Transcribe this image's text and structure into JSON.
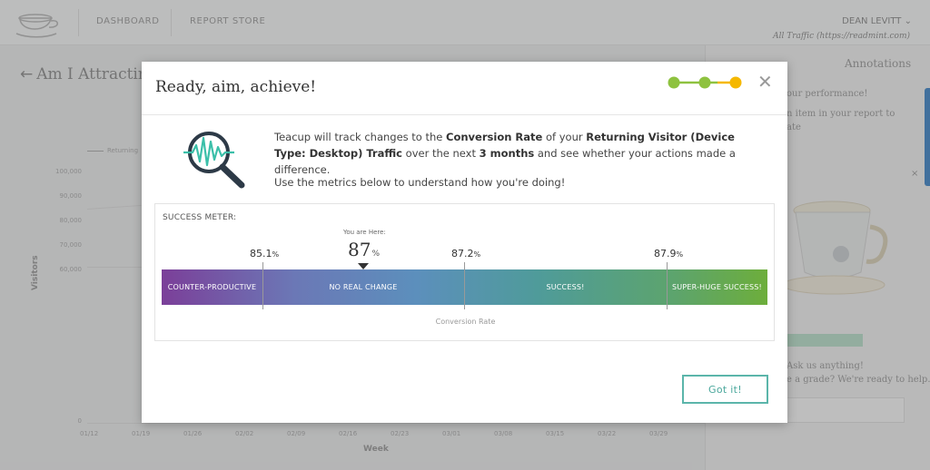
{
  "nav": {
    "dashboard": "DASHBOARD",
    "report_store": "REPORT STORE",
    "user": "DEAN LEVITT",
    "site": "All Traffic (https://readmint.com)"
  },
  "page": {
    "title": "Am I Attracting",
    "legend": "Returning",
    "y_axis_label": "Visitors",
    "x_axis_label": "Week",
    "y_ticks": [
      "100,000",
      "90,000",
      "80,000",
      "70,000",
      "60,000",
      "0"
    ],
    "x_ticks": [
      "01/12",
      "01/19",
      "01/26",
      "02/02",
      "02/09",
      "02/16",
      "02/23",
      "03/01",
      "03/08",
      "03/15",
      "03/22",
      "03/29"
    ]
  },
  "right_panel": {
    "tab_annotations": "Annotations",
    "line1": "our performance!",
    "line2": "n item in your report to",
    "line3": "ate",
    "line4": "Ask us anything!",
    "line5": "e a grade? We're ready to help."
  },
  "modal": {
    "title": "Ready, aim, achieve!",
    "progress_steps": 3,
    "current_step": 3,
    "msg_intro": "Teacup will track changes to the ",
    "metric": "Conversion Rate",
    "msg_mid": " of your ",
    "segment": "Returning Visitor (Device Type: Desktop) Traffic",
    "msg_over": " over the next ",
    "duration": "3 months",
    "msg_end": " and see whether your actions made a difference.",
    "msg2": "Use the metrics below to understand how you're doing!",
    "meter": {
      "title": "SUCCESS METER:",
      "here_label": "You are Here:",
      "current_value": "87",
      "pct": "%",
      "thresholds": [
        "85.1",
        "87.2",
        "87.9"
      ],
      "segments": [
        "COUNTER-PRODUCTIVE",
        "NO REAL CHANGE",
        "SUCCESS!",
        "SUPER-HUGE SUCCESS!"
      ],
      "axis_label": "Conversion Rate"
    },
    "button": "Got it!"
  },
  "colors": {
    "accent_teal": "#5bb5aa",
    "progress_green": "#8ec23f",
    "progress_yellow": "#f5b800"
  }
}
